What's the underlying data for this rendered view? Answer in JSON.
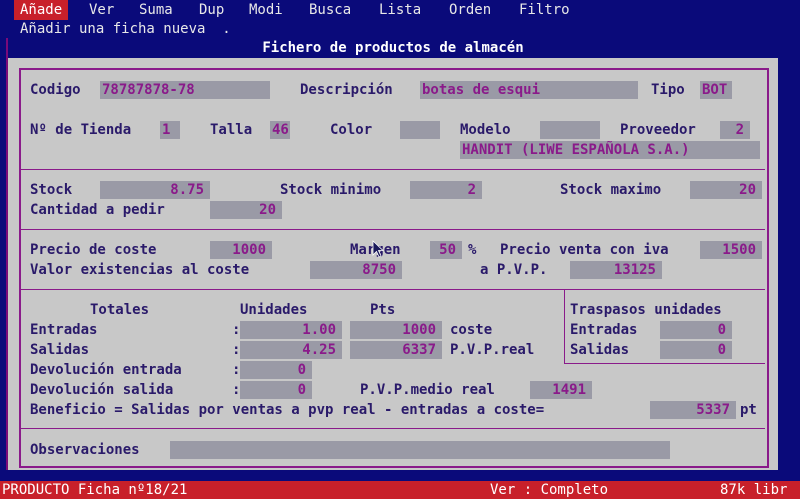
{
  "menu": {
    "items": [
      "Añade",
      "Ver",
      "Suma",
      "Dup",
      "Modi",
      "Busca",
      "Lista",
      "Orden",
      "Filtro"
    ],
    "hint": "Añadir una ficha nueva  ."
  },
  "window": {
    "title": "Fichero de productos de almacén"
  },
  "producto": {
    "codigo_label": "Codigo",
    "codigo": "78787878-78",
    "descripcion_label": "Descripción",
    "descripcion": "botas de esqui",
    "tipo_label": "Tipo",
    "tipo": "BOT",
    "tienda_label": "Nº de Tienda",
    "tienda": "1",
    "talla_label": "Talla",
    "talla": "46",
    "color_label": "Color",
    "color": "",
    "modelo_label": "Modelo",
    "modelo": "",
    "proveedor_label": "Proveedor",
    "proveedor": "2",
    "proveedor_nombre": "HANDIT (LIWE ESPAÑOLA S.A.)"
  },
  "stock": {
    "stock_label": "Stock",
    "stock": "8.75",
    "minimo_label": "Stock minimo",
    "minimo": "2",
    "maximo_label": "Stock maximo",
    "maximo": "20",
    "pedir_label": "Cantidad a pedir",
    "pedir": "20"
  },
  "precios": {
    "coste_label": "Precio de coste",
    "coste": "1000",
    "margen_label": "Margen",
    "margen": "50",
    "pct": "%",
    "venta_label": "Precio venta con iva",
    "venta": "1500",
    "valor_label": "Valor existencias al coste",
    "valor": "8750",
    "pvp_label": "a P.V.P.",
    "pvp": "13125"
  },
  "totales": {
    "header_totales": "Totales",
    "header_unidades": "Unidades",
    "header_pts": "Pts",
    "entradas_label": "Entradas",
    "entradas_u": "1.00",
    "entradas_p": "1000",
    "entradas_tag": "coste",
    "salidas_label": "Salidas",
    "salidas_u": "4.25",
    "salidas_p": "6337",
    "salidas_tag": "P.V.P.real",
    "dev_entrada_label": "Devolución entrada",
    "dev_entrada": "0",
    "dev_salida_label": "Devolución salida",
    "dev_salida": "0",
    "colon": ":",
    "pvp_medio_label": "P.V.P.medio real",
    "pvp_medio": "1491",
    "beneficio_label": "Beneficio = Salidas por ventas a pvp real - entradas a coste=",
    "beneficio": "5337",
    "beneficio_unit": "pt"
  },
  "traspasos": {
    "header": "Traspasos unidades",
    "entradas_label": "Entradas",
    "entradas": "0",
    "salidas_label": "Salidas",
    "salidas": "0"
  },
  "observaciones": {
    "label": "Observaciones",
    "value": ""
  },
  "status": {
    "left": "PRODUCTO Ficha nº18/21",
    "mid": "Ver : Completo",
    "right": "87k libr"
  },
  "colors": {
    "background": "#0a0a7a",
    "form": "#c8c8c8",
    "field": "#9a9aa6",
    "accent": "#c8202a",
    "border": "#8a1a8a"
  }
}
